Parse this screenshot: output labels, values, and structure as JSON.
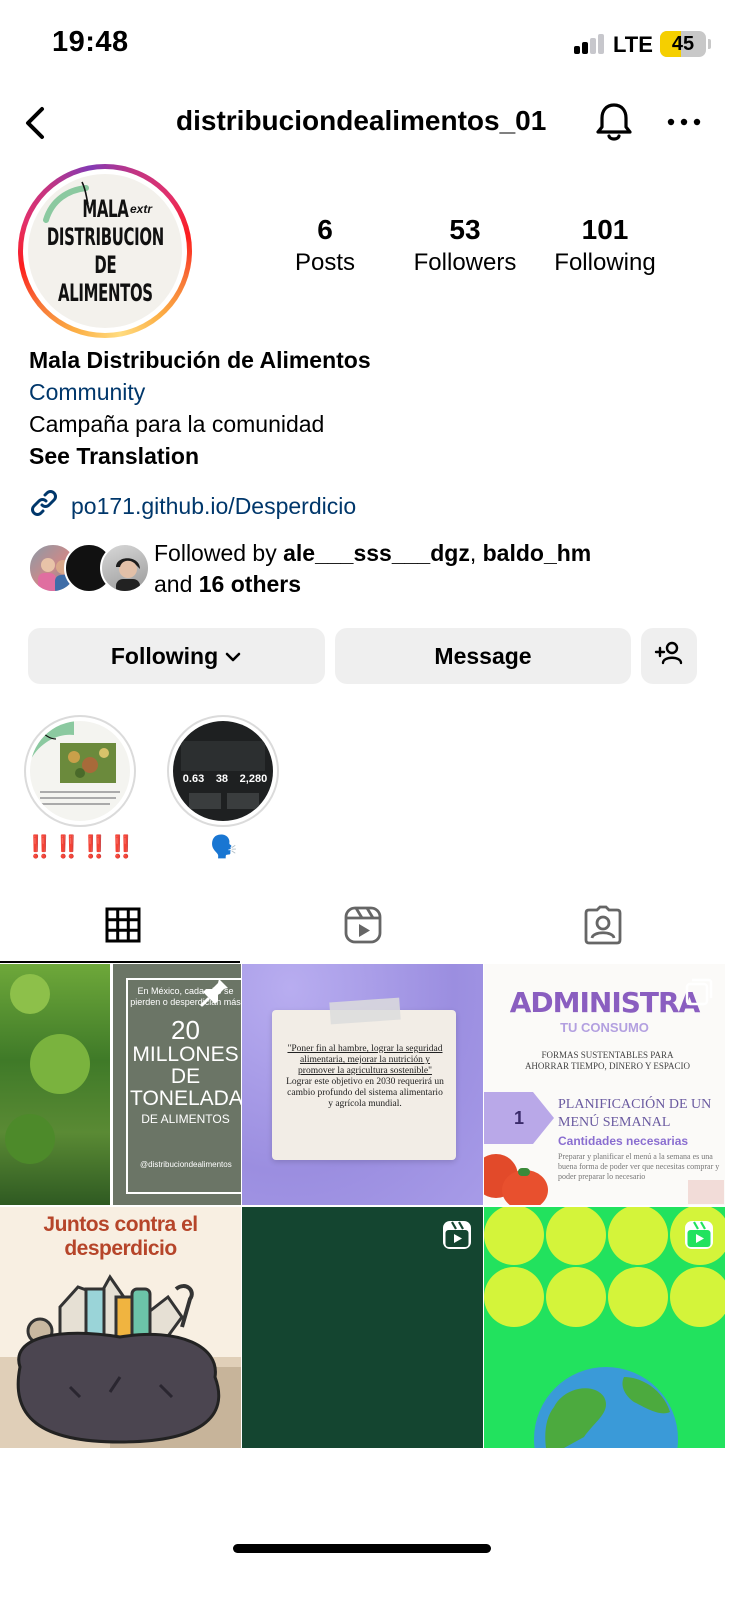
{
  "status_bar": {
    "time": "19:48",
    "network": "LTE",
    "battery": "45",
    "battery_level": 0.45
  },
  "header": {
    "username": "distribuciondealimentos_01"
  },
  "profile": {
    "avatar_text": "MALA\nDISTRIBUCION DE\nALIMENTOS",
    "avatar_extra": "extr",
    "stats": [
      {
        "value": "6",
        "label": "Posts"
      },
      {
        "value": "53",
        "label": "Followers"
      },
      {
        "value": "101",
        "label": "Following"
      }
    ],
    "name": "Mala Distribución de Alimentos",
    "category": "Community",
    "bio": "Campaña para la comunidad",
    "see_translation": "See Translation",
    "link": "po171.github.io/Desperdicio",
    "followed_by": {
      "prefix": "Followed by ",
      "user1": "ale___sss___dgz",
      "separator": ", ",
      "user2": "baldo_hm",
      "middle": "and ",
      "others": "16 others"
    }
  },
  "actions": {
    "following": "Following",
    "message": "Message"
  },
  "highlights": [
    {
      "label": "‼️‼️‼️‼️"
    },
    {
      "label": "🗣️",
      "stats": [
        "0.63",
        "38",
        "2,280"
      ]
    }
  ],
  "tabs": [
    "grid-icon",
    "reels-icon",
    "tagged-icon"
  ],
  "posts": [
    {
      "kind": "image",
      "pinned": true,
      "lines": [
        "En México, cada año se",
        "pierden o desperdician más",
        "20",
        "MILLONES",
        "DE",
        "TONELADAS",
        "DE ALIMENTOS"
      ],
      "handle": "@distribuciondealimentos"
    },
    {
      "kind": "image",
      "quote": "\"Poner fin al hambre, lograr la seguridad alimentaria, mejorar la nutrición y promover la agricultura sostenible\"",
      "body": "Lograr este objetivo en 2030 requerirá un cambio profundo del sistema alimentario y agrícola mundial."
    },
    {
      "kind": "carousel",
      "title": "ADMINISTRA",
      "subtitle": "TU CONSUMO",
      "tagline": "FORMAS SUSTENTABLES PARA AHORRAR TIEMPO, DINERO Y ESPACIO",
      "step": "1",
      "heading": "PLANIFICACIÓN DE UN MENÚ SEMANAL",
      "subheading": "Cantidades necesarias",
      "body": "Preparar y planificar el menú a la semana es una buena forma de poder ver que necesitas comprar y poder preparar lo necesario"
    },
    {
      "kind": "image",
      "title": "Juntos contra el desperdicio"
    },
    {
      "kind": "reel"
    },
    {
      "kind": "reel"
    }
  ],
  "colors": {
    "link": "#00376b",
    "button_bg": "#efefef",
    "battery": "#f5cf00"
  }
}
